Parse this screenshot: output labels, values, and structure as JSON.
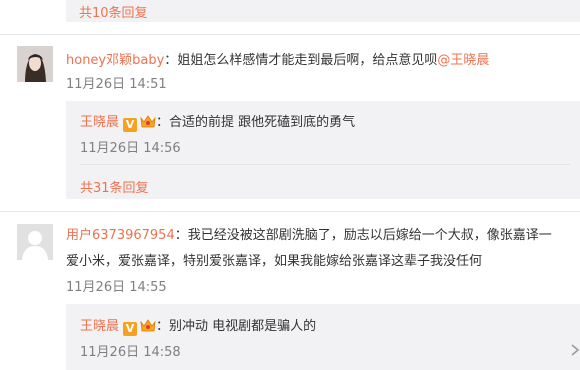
{
  "thread1": {
    "more_replies": "共10条回复"
  },
  "comment1": {
    "username": "honey邓颖baby",
    "colon": "：",
    "text": "姐姐怎么样感情才能走到最后啊，给点意见呗",
    "mention": "@王晓晨",
    "time": "11月26日 14:51",
    "avatar_icon": "user-photo-avatar"
  },
  "reply1": {
    "username": "王晓晨",
    "verified_icon": "verified-v-icon",
    "member_icon": "member-crown-icon",
    "colon": "：",
    "text": "合适的前提 跟他死磕到底的勇气",
    "time": "11月26日 14:56"
  },
  "thread2": {
    "more_replies": "共31条回复"
  },
  "comment2": {
    "username": "用户6373967954",
    "colon": "：",
    "text_line1": "我已经没被这部剧洗脑了，励志以后嫁给一个大叔，像张嘉译一",
    "text_line2": "爱小米，爱张嘉译，特别爱张嘉译，如果我能嫁给张嘉译这辈子我没任何",
    "time": "11月26日 14:55",
    "avatar_icon": "default-user-avatar"
  },
  "reply2": {
    "username": "王晓晨",
    "verified_icon": "verified-v-icon",
    "member_icon": "member-crown-icon",
    "colon": "：",
    "text": "别冲动 电视剧都是骗人的",
    "time": "11月26日 14:58",
    "scroll_icon": "scroll-arrow-icon"
  },
  "colors": {
    "link": "#eb7350",
    "reply_bg": "#f2f2f5",
    "time": "#808080",
    "badge": "#f7a11f"
  }
}
